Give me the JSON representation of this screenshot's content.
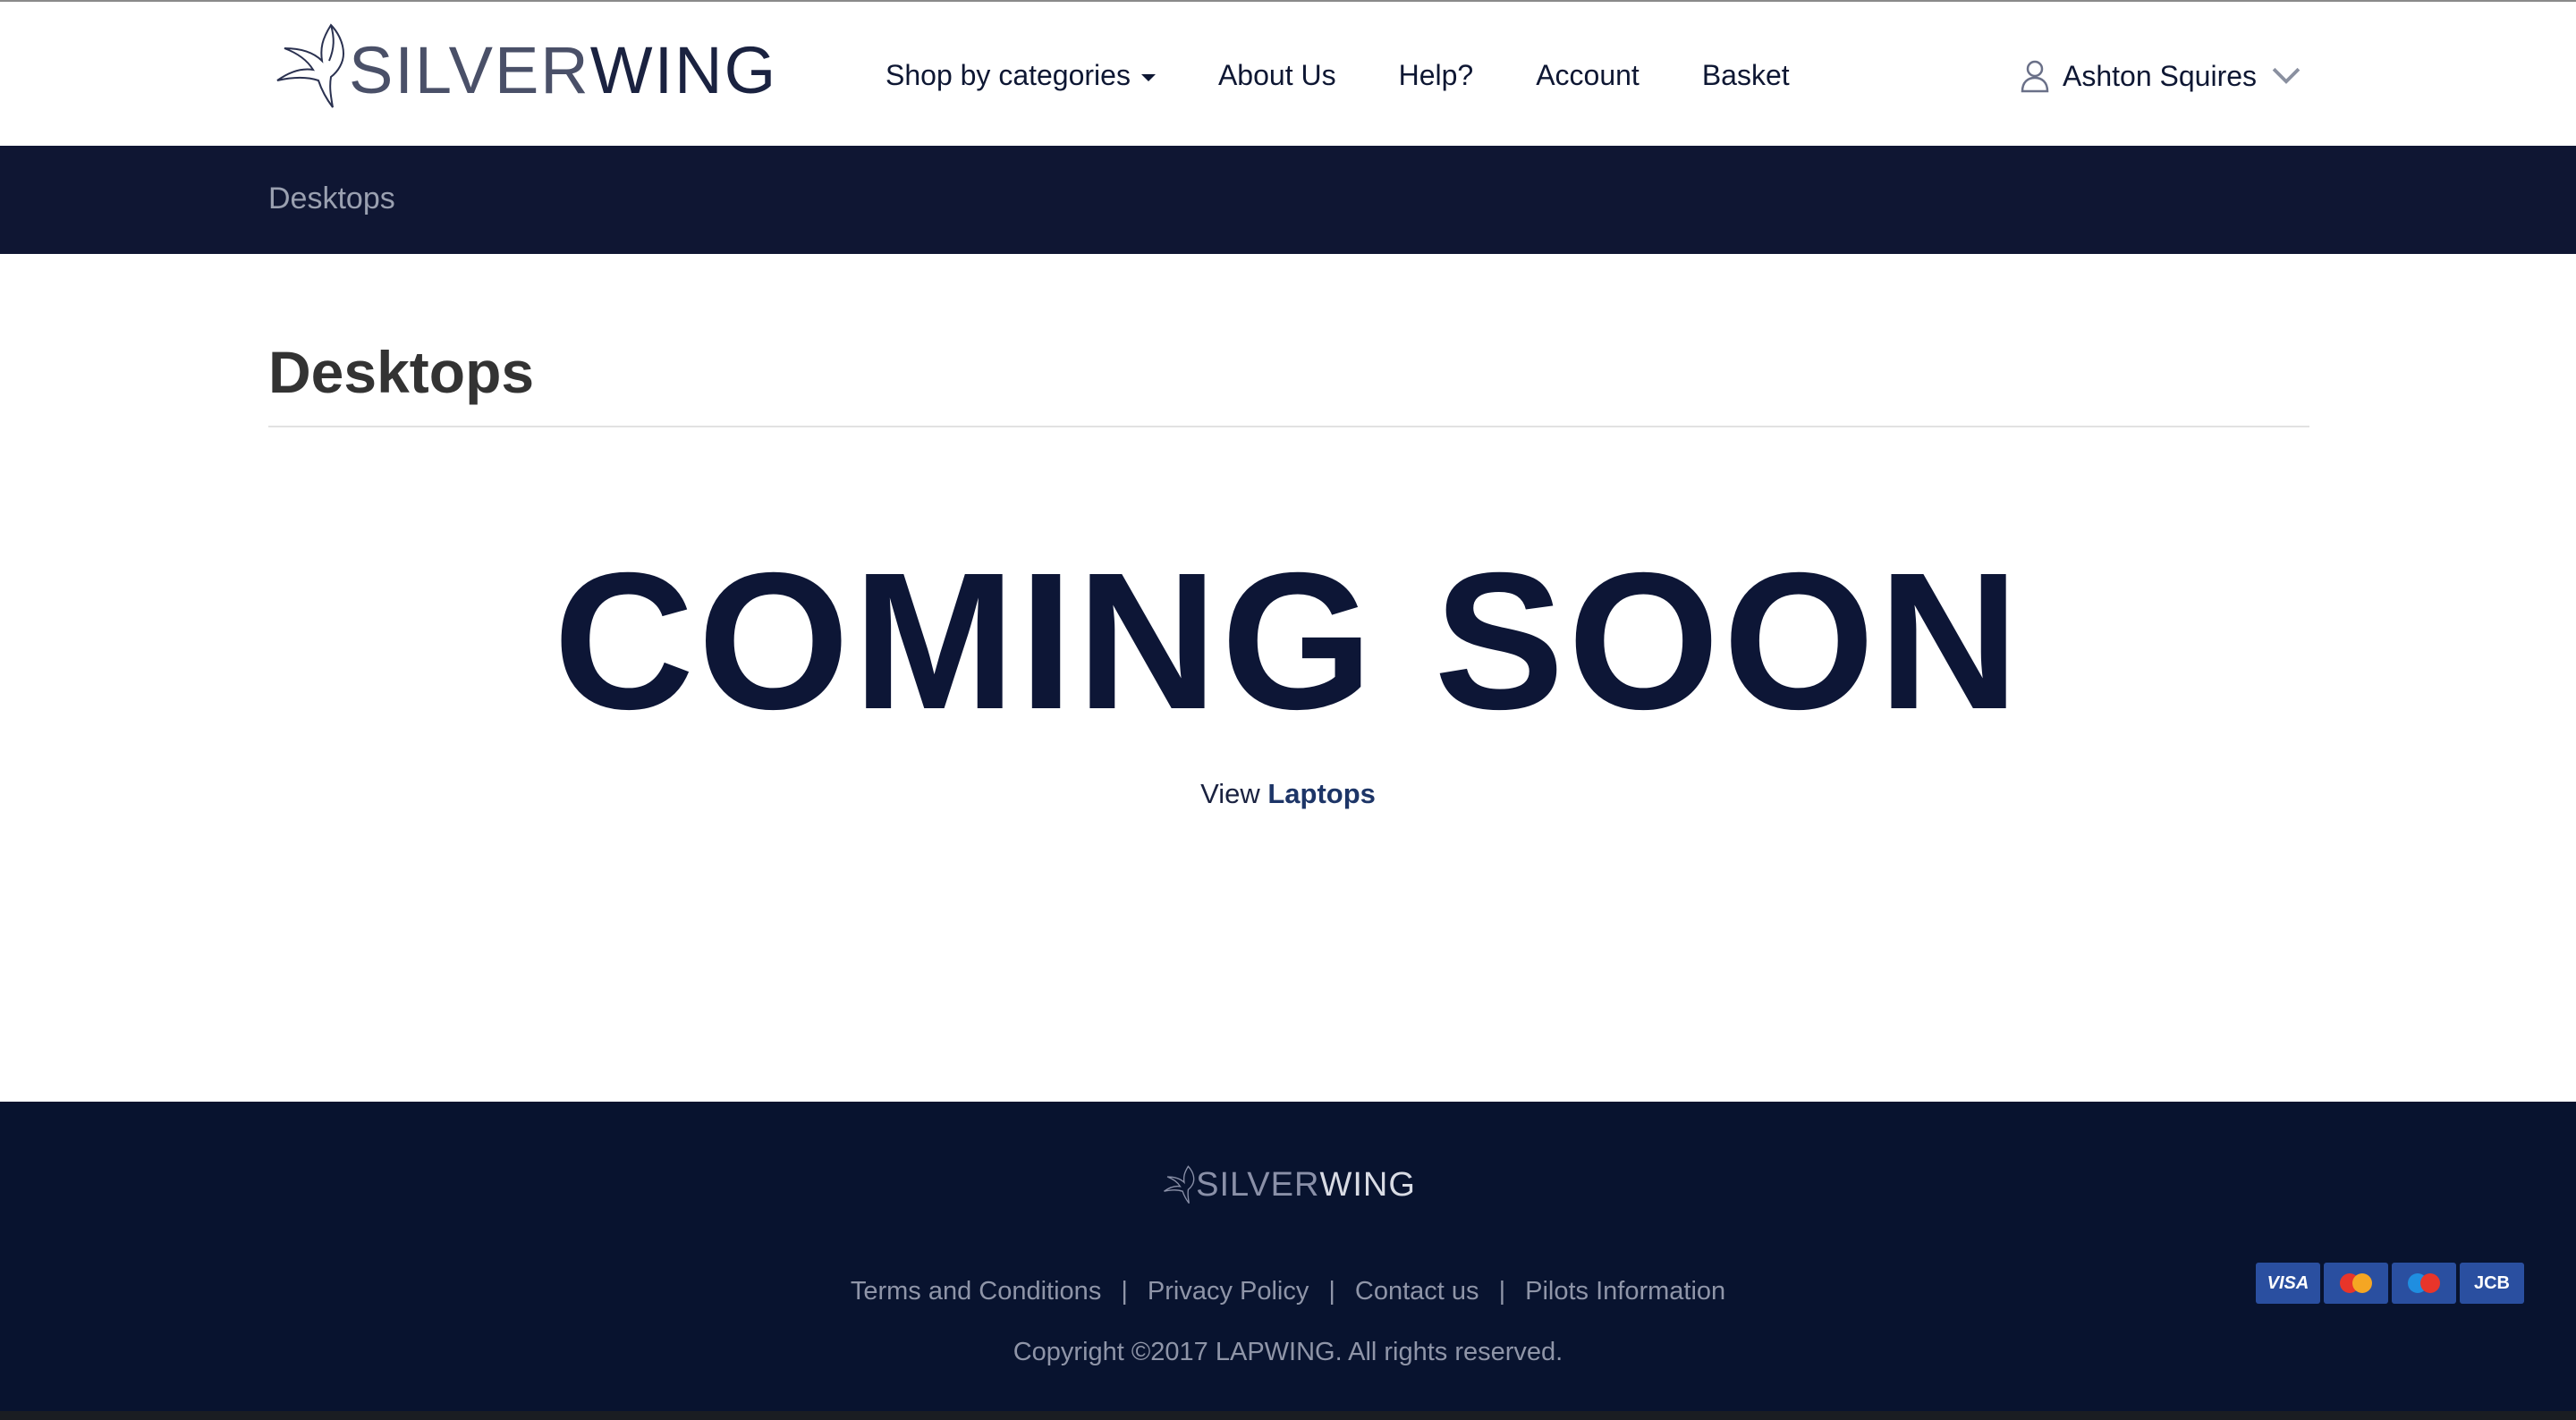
{
  "brand": {
    "name_thin": "SILVER",
    "name_bold": "WING"
  },
  "nav": {
    "items": [
      {
        "label": "Shop by categories",
        "has_dropdown": true
      },
      {
        "label": "About Us"
      },
      {
        "label": "Help?"
      },
      {
        "label": "Account"
      },
      {
        "label": "Basket"
      }
    ]
  },
  "user": {
    "name": "Ashton Squires",
    "icon": "user-icon"
  },
  "breadcrumb": {
    "current": "Desktops"
  },
  "main": {
    "title": "Desktops",
    "headline": "COMING SOON",
    "view_prefix": "View",
    "view_link": "Laptops"
  },
  "footer": {
    "links": [
      "Terms and Conditions",
      "Privacy Policy",
      "Contact us",
      "Pilots Information"
    ],
    "copyright": "Copyright ©2017 LAPWING. All rights reserved.",
    "payment_cards": [
      "VISA",
      "MasterCard",
      "Maestro",
      "JCB"
    ]
  },
  "colors": {
    "navy": "#0f1633",
    "footer_bg": "#08132f",
    "text": "#0e1733",
    "link": "#1d3567"
  }
}
